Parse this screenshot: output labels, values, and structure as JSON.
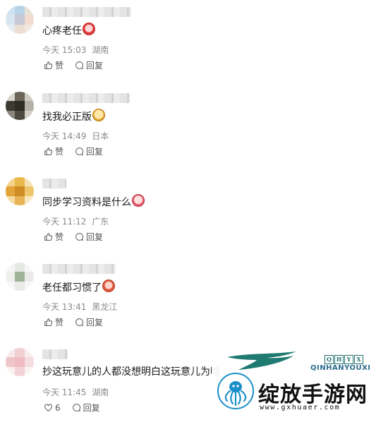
{
  "comments": [
    {
      "text": "心疼老任",
      "time": "今天 15:03",
      "location": "湖南",
      "like_label": "赞",
      "reply_label": "回复"
    },
    {
      "text": "找我必正版",
      "time": "今天 14:49",
      "location": "日本",
      "like_label": "赞",
      "reply_label": "回复"
    },
    {
      "text": "同步学习资料是什么",
      "time": "今天 11:12",
      "location": "广东",
      "like_label": "赞",
      "reply_label": "回复"
    },
    {
      "text": "老任都习惯了",
      "time": "今天 13:41",
      "location": "黑龙江",
      "like_label": "赞",
      "reply_label": "回复"
    },
    {
      "text": "抄这玩意儿的人都没想明白这玩意儿为啥",
      "time": "今天 11:45",
      "location": "湖南",
      "like_label": "6",
      "reply_label": "回复"
    }
  ],
  "watermark": {
    "badge": "QHYX",
    "subtitle": "QINHANYOUXI",
    "title": "绽放手游网",
    "url": "www.gxhuaer.com"
  },
  "colors": {
    "meta_text": "#8a8a8a",
    "brand_teal": "#1e6f6a"
  }
}
